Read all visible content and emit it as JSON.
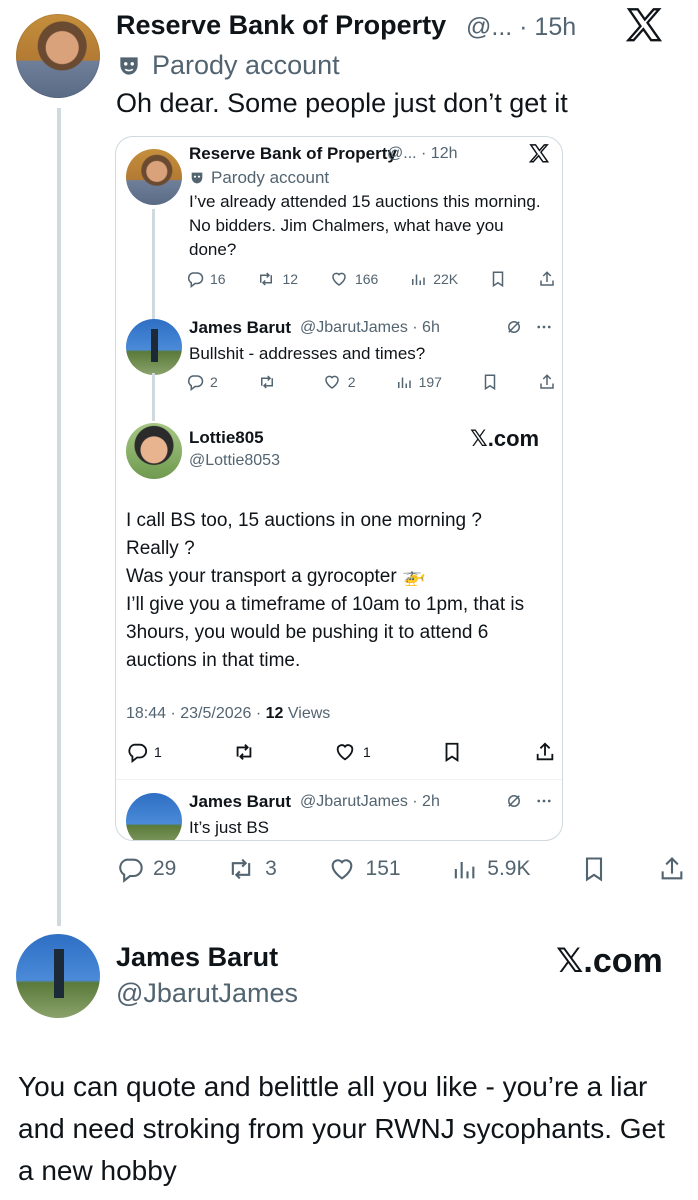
{
  "main_tweet": {
    "author_name": "Reserve Bank of Property",
    "handle_time": "@... · 15h",
    "parody_label": "Parody account",
    "text": "Oh dear. Some people just don’t get it",
    "actions": {
      "replies": "29",
      "reposts": "3",
      "likes": "151",
      "views": "5.9K"
    }
  },
  "quote": {
    "tweet1": {
      "author_name": "Reserve Bank of Property",
      "handle_time": "@... · 12h",
      "parody_label": "Parody account",
      "text": "I’ve already attended 15 auctions this morning. No bidders. Jim Chalmers, what have you done?",
      "actions": {
        "replies": "16",
        "reposts": "12",
        "likes": "166",
        "views": "22K"
      }
    },
    "tweet2": {
      "author_name": "James Barut",
      "handle_time": "@JbarutJames · 6h",
      "text": "Bullshit - addresses and times?",
      "actions": {
        "replies": "2",
        "reposts": "",
        "likes": "2",
        "views": "197"
      }
    },
    "tweet3": {
      "author_name": "Lottie805",
      "handle": "@Lottie8053",
      "site": "𝕏.com",
      "text_lines": [
        "I call BS too, 15 auctions in one morning ?",
        "Really ?",
        "Was your transport a gyrocopter 🚁",
        "I’ll give you a timeframe of 10am to 1pm, that is 3hours, you would be pushing it to attend 6 auctions in that time."
      ],
      "timestamp": "18:44 · 23/5/2026 · ",
      "views_count": "12",
      "views_label": " Views",
      "actions": {
        "replies": "1",
        "reposts": "",
        "likes": "1"
      }
    },
    "tweet4": {
      "author_name": "James Barut",
      "handle_time": "@JbarutJames · 2h",
      "text": "It’s just BS"
    }
  },
  "reply_tweet": {
    "author_name": "James Barut",
    "handle": "@JbarutJames",
    "site": "𝕏.com",
    "text": "You can quote and belittle all you like - you’re a liar and need stroking from your RWNJ sycophants. Get a new hobby"
  }
}
